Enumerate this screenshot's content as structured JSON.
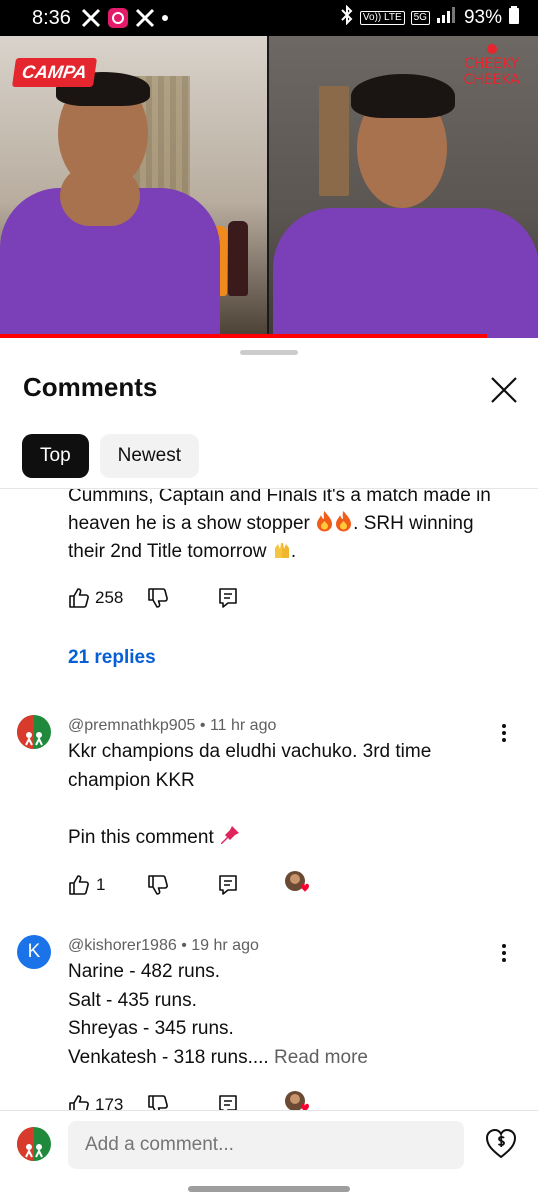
{
  "status_bar": {
    "time": "8:36",
    "network": "5G",
    "volte": "Vo)) LTE",
    "battery": "93%"
  },
  "video": {
    "left_logo": "CAMPA",
    "right_logo_line1": "CHEEKY",
    "right_logo_line2": "CHEEKA",
    "progress_fraction": 0.905
  },
  "comments_sheet": {
    "title": "Comments",
    "chips": [
      {
        "label": "Top",
        "selected": true
      },
      {
        "label": "Newest",
        "selected": false
      }
    ]
  },
  "comments": [
    {
      "partial_lines": [
        "Cummins, Captain and Finals it's a match made in",
        "heaven he is a show stopper",
        ". SRH winning",
        "their 2nd Title tomorrow",
        "."
      ],
      "likes": "258",
      "replies": "21 replies"
    },
    {
      "author": "@premnathkp905",
      "time": "11 hr ago",
      "lines": [
        "Kkr champions da eludhi vachuko. 3rd time",
        "champion KKR",
        "",
        "Pin this comment"
      ],
      "likes": "1"
    },
    {
      "author": "@kishorer1986",
      "time": "19 hr ago",
      "avatar_letter": "K",
      "lines": [
        "Narine - 482 runs.",
        "Salt - 435 runs.",
        "Shreyas - 345 runs.",
        "Venkatesh - 318 runs...."
      ],
      "read_more": "Read more",
      "likes": "173"
    }
  ],
  "composer": {
    "placeholder": "Add a comment..."
  },
  "colors": {
    "accent_blue": "#065fd4",
    "avatar_k": "#1a73e8",
    "progress_red": "#ff0000"
  }
}
